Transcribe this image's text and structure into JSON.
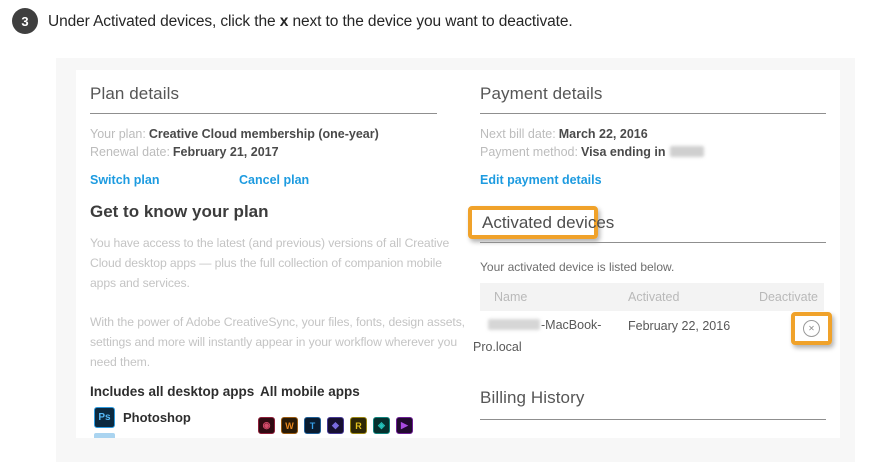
{
  "step": {
    "number": "3",
    "text_before": "Under Activated devices, click the ",
    "emphasis": "x",
    "text_after": " next to the device you want to deactivate."
  },
  "colors": {
    "highlight_orange": "#f0a22a",
    "link_blue": "#1d9be0"
  },
  "plan_details": {
    "title": "Plan details",
    "your_plan_label": "Your plan:",
    "your_plan_value": "Creative Cloud membership (one-year)",
    "renewal_label": "Renewal date:",
    "renewal_value": "February 21, 2017",
    "switch_plan_link": "Switch plan",
    "cancel_plan_link": "Cancel plan"
  },
  "get_to_know": {
    "title": "Get to know your plan",
    "p1": {
      "line1": "You have access to the latest (and previous) versions of all Creative",
      "line2": "Cloud desktop apps — plus the full collection of companion mobile",
      "line3": "apps and services."
    },
    "p2": {
      "line1": "With the power of Adobe CreativeSync, your files, fonts, design assets,",
      "line2": "settings and more will instantly appear in your workflow wherever you",
      "line3": "need them."
    }
  },
  "apps": {
    "desktop_title": "Includes all desktop apps",
    "mobile_title": "All mobile apps",
    "photoshop_badge": "Ps",
    "photoshop_label": "Photoshop",
    "mobile_icons": [
      {
        "name": "mobile-app-1",
        "glyph": "◉"
      },
      {
        "name": "mobile-app-2",
        "glyph": "W"
      },
      {
        "name": "mobile-app-3",
        "glyph": "T"
      },
      {
        "name": "mobile-app-4",
        "glyph": "◆"
      },
      {
        "name": "mobile-app-5",
        "glyph": "R"
      },
      {
        "name": "mobile-app-6",
        "glyph": "◈"
      },
      {
        "name": "mobile-app-7",
        "glyph": "▶"
      }
    ]
  },
  "payment_details": {
    "title": "Payment details",
    "next_bill_label": "Next bill date:",
    "next_bill_value": "March 22, 2016",
    "method_label": "Payment method:",
    "method_value": "Visa ending in",
    "edit_link": "Edit payment details"
  },
  "activated_devices": {
    "title": "Activated devices",
    "note": "Your activated device is listed below.",
    "table": {
      "headers": [
        "Name",
        "Activated",
        "Deactivate"
      ],
      "row": {
        "name_line1": "-MacBook-",
        "name_line2": "Pro.local",
        "activated": "February 22, 2016",
        "deactivate_glyph": "✕"
      }
    }
  },
  "billing_history": {
    "title": "Billing History"
  }
}
